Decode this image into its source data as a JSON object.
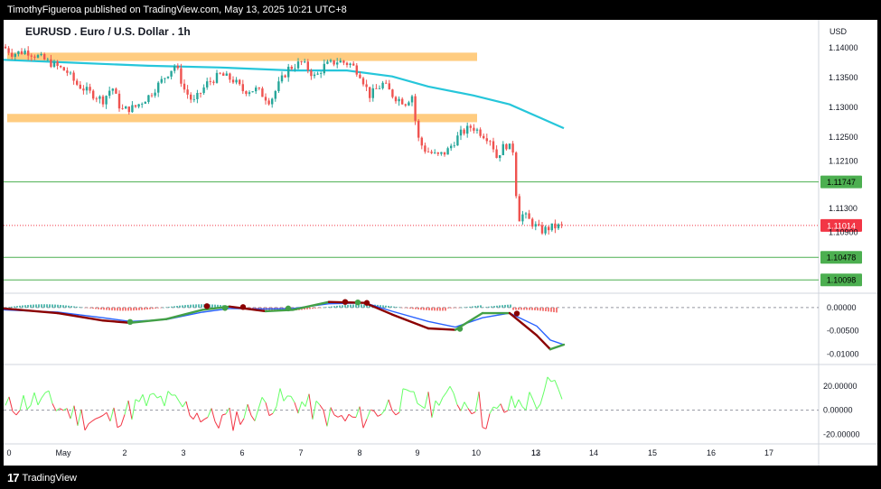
{
  "header": {
    "publish_text": "TimothyFigueroa published on TradingView.com, May 13, 2025 10:21 UTC+8"
  },
  "footer": {
    "brand": "TradingView",
    "logo_icon": "tradingview-logo-icon"
  },
  "chart_data": [
    {
      "type": "candlestick",
      "title": "EURUSD . Euro / U.S. Dollar . 1h",
      "currency_label": "USD",
      "y_ticks": [
        "1.14000",
        "1.13500",
        "1.13000",
        "1.12500",
        "1.12100",
        "1.11300",
        "1.10900"
      ],
      "ylim": [
        1.0995,
        1.1432
      ],
      "x_ticks": [
        "0",
        "May",
        "2",
        "3",
        "6",
        "7",
        "8",
        "9",
        "10",
        "12",
        "13",
        "14",
        "15",
        "16",
        "17"
      ],
      "horizontal_levels": [
        {
          "value": 1.11747,
          "label": "1.11747",
          "color": "#4caf50"
        },
        {
          "value": 1.10478,
          "label": "1.10478",
          "color": "#4caf50"
        },
        {
          "value": 1.10098,
          "label": "1.10098",
          "color": "#4caf50"
        }
      ],
      "current_price": {
        "value": 1.11014,
        "label": "1.11014",
        "color": "#f23645"
      },
      "zones": [
        {
          "from": 1.1378,
          "to": 1.1392,
          "x_start": "0",
          "x_end": "10",
          "color": "#ffcc80"
        },
        {
          "from": 1.1275,
          "to": 1.1289,
          "x_start": "0",
          "x_end": "10",
          "color": "#ffcc80"
        }
      ],
      "moving_average": {
        "color": "#26c6da"
      },
      "up_color": "#26a69a",
      "down_color": "#ef5350"
    },
    {
      "type": "line",
      "panel": "oscillator",
      "y_ticks": [
        "0.00000",
        "-0.00500",
        "-0.01000"
      ],
      "ylim": [
        -0.0115,
        0.0025
      ],
      "zero_line": true
    },
    {
      "type": "line",
      "panel": "rsi-like",
      "y_ticks": [
        "20.00000",
        "0.00000",
        "-20.00000"
      ],
      "ylim": [
        -25,
        35
      ],
      "zero_line": true,
      "up_color": "#66ff66",
      "down_color": "#f23645"
    }
  ]
}
